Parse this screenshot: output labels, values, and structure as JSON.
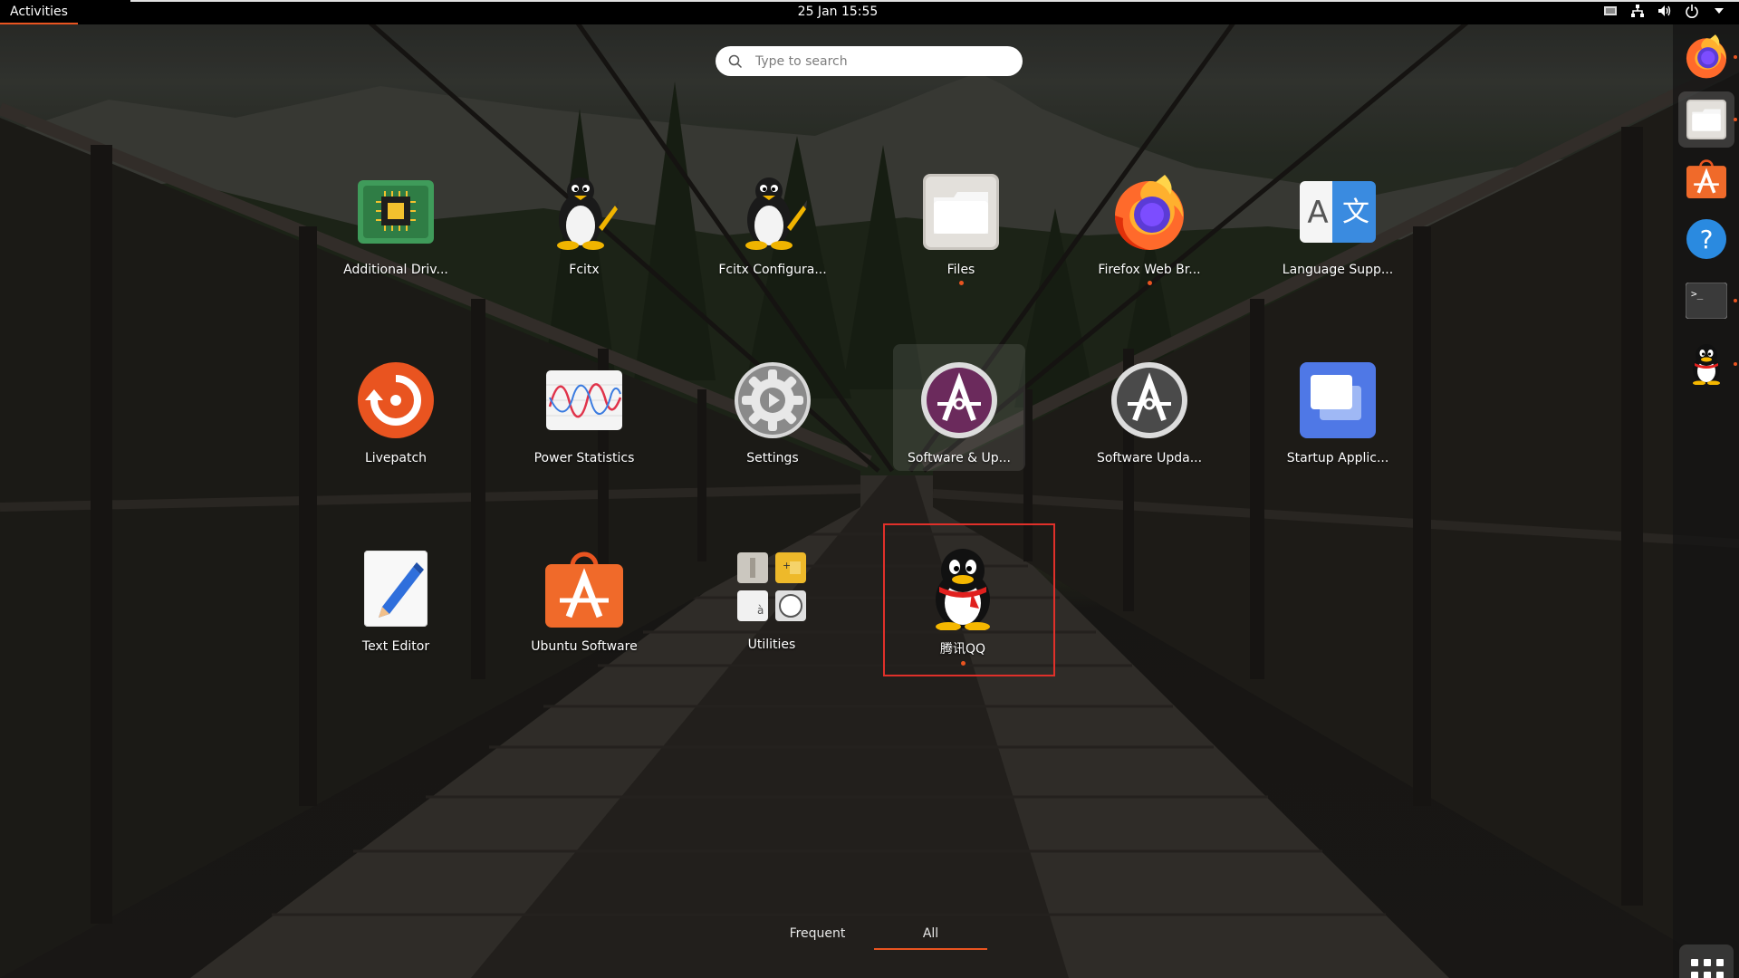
{
  "topbar": {
    "activities": "Activities",
    "clock": "25 Jan  15:55",
    "tray": [
      "screen-icon",
      "network-icon",
      "volume-icon",
      "power-icon",
      "chevron-down-icon"
    ]
  },
  "search": {
    "placeholder": "Type to search"
  },
  "apps": [
    {
      "label": "Additional Driv...",
      "icon": "chip-icon",
      "running": false
    },
    {
      "label": "Fcitx",
      "icon": "tux-icon",
      "running": false
    },
    {
      "label": "Fcitx Configura...",
      "icon": "tux-icon",
      "running": false
    },
    {
      "label": "Files",
      "icon": "folder-icon",
      "running": true
    },
    {
      "label": "Firefox Web Br...",
      "icon": "firefox-icon",
      "running": true
    },
    {
      "label": "Language Supp...",
      "icon": "language-icon",
      "running": false
    },
    {
      "label": "Livepatch",
      "icon": "livepatch-icon",
      "running": false
    },
    {
      "label": "Power Statistics",
      "icon": "power-statistics-icon",
      "running": false
    },
    {
      "label": "Settings",
      "icon": "gear-icon",
      "running": false
    },
    {
      "label": "Software & Up...",
      "icon": "software-properties-icon",
      "running": false
    },
    {
      "label": "Software Upda...",
      "icon": "software-updater-icon",
      "running": false
    },
    {
      "label": "Startup Applic...",
      "icon": "startup-apps-icon",
      "running": false
    },
    {
      "label": "Text Editor",
      "icon": "text-editor-icon",
      "running": false
    },
    {
      "label": "Ubuntu Software",
      "icon": "ubuntu-software-icon",
      "running": false
    },
    {
      "label": "Utilities",
      "icon": "utilities-folder-icon",
      "running": false
    },
    {
      "label": "腾讯QQ",
      "icon": "qq-penguin-icon",
      "running": true
    }
  ],
  "tabs": {
    "frequent": "Frequent",
    "all": "All",
    "selected": "All"
  },
  "dock": {
    "items": [
      "firefox-icon",
      "folder-icon",
      "ubuntu-software-icon",
      "help-icon",
      "terminal-icon",
      "qq-penguin-icon"
    ],
    "show_apps": "grid-icon"
  },
  "colors": {
    "accent": "#e95420",
    "highlight_box": "#e0302a"
  }
}
